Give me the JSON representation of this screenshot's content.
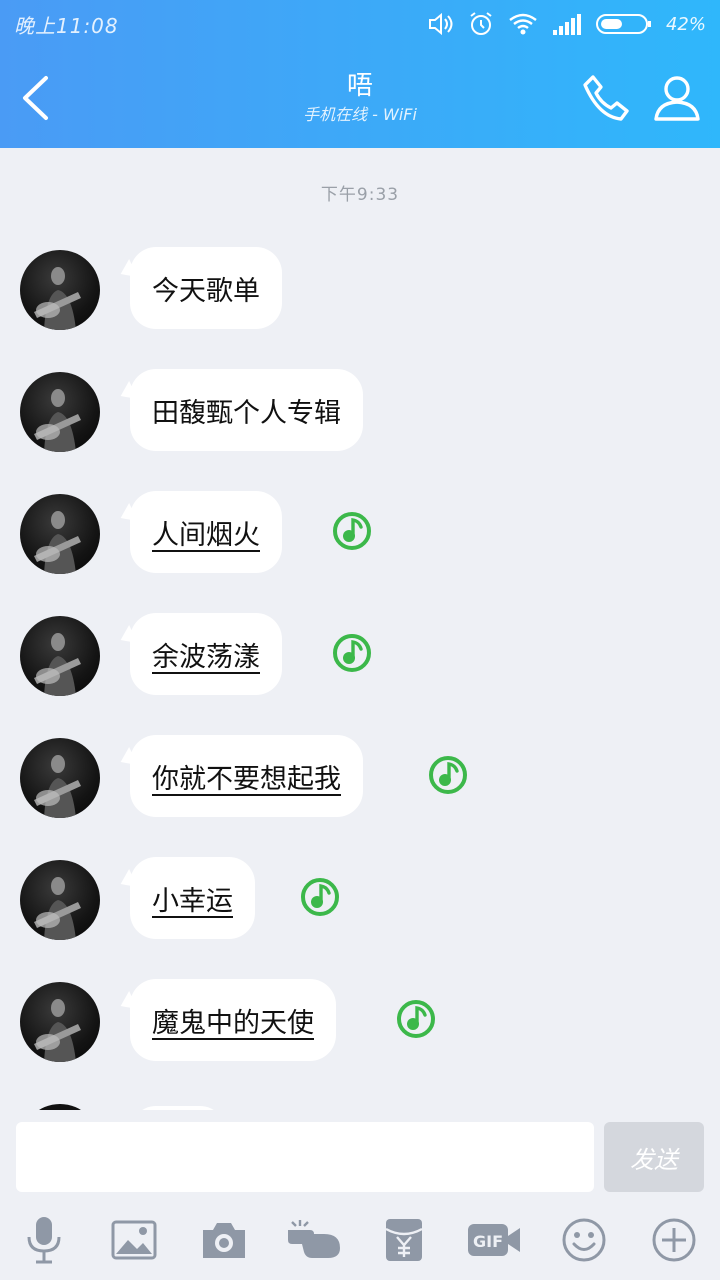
{
  "status_bar": {
    "time": "晚上11:08",
    "battery_percent": "42%",
    "icons": [
      "volume-icon",
      "alarm-icon",
      "wifi-icon",
      "signal-icon",
      "battery-icon"
    ]
  },
  "header": {
    "title": "唔",
    "subtitle": "手机在线 - WiFi",
    "back_icon": "back-arrow-icon",
    "call_icon": "phone-icon",
    "profile_icon": "profile-icon"
  },
  "chat": {
    "timestamp": "下午9:33",
    "messages": [
      {
        "text": "今天歌单",
        "is_song": false
      },
      {
        "text": "田馥甄个人专辑",
        "is_song": false
      },
      {
        "text": "人间烟火",
        "is_song": true
      },
      {
        "text": "余波荡漾",
        "is_song": true
      },
      {
        "text": "你就不要想起我",
        "is_song": true
      },
      {
        "text": "小幸运",
        "is_song": true
      },
      {
        "text": "魔鬼中的天使",
        "is_song": true
      }
    ]
  },
  "composer": {
    "input_value": "",
    "send_label": "发送",
    "tools": [
      "microphone-icon",
      "image-icon",
      "camera-icon",
      "poke-hand-icon",
      "red-packet-icon",
      "gif-icon",
      "emoji-icon",
      "plus-icon"
    ]
  },
  "colors": {
    "header_start": "#4a9bf5",
    "header_end": "#2fb7fb",
    "background": "#eef0f5",
    "music_green": "#3cb84a",
    "send_disabled": "#d4d7dd"
  }
}
